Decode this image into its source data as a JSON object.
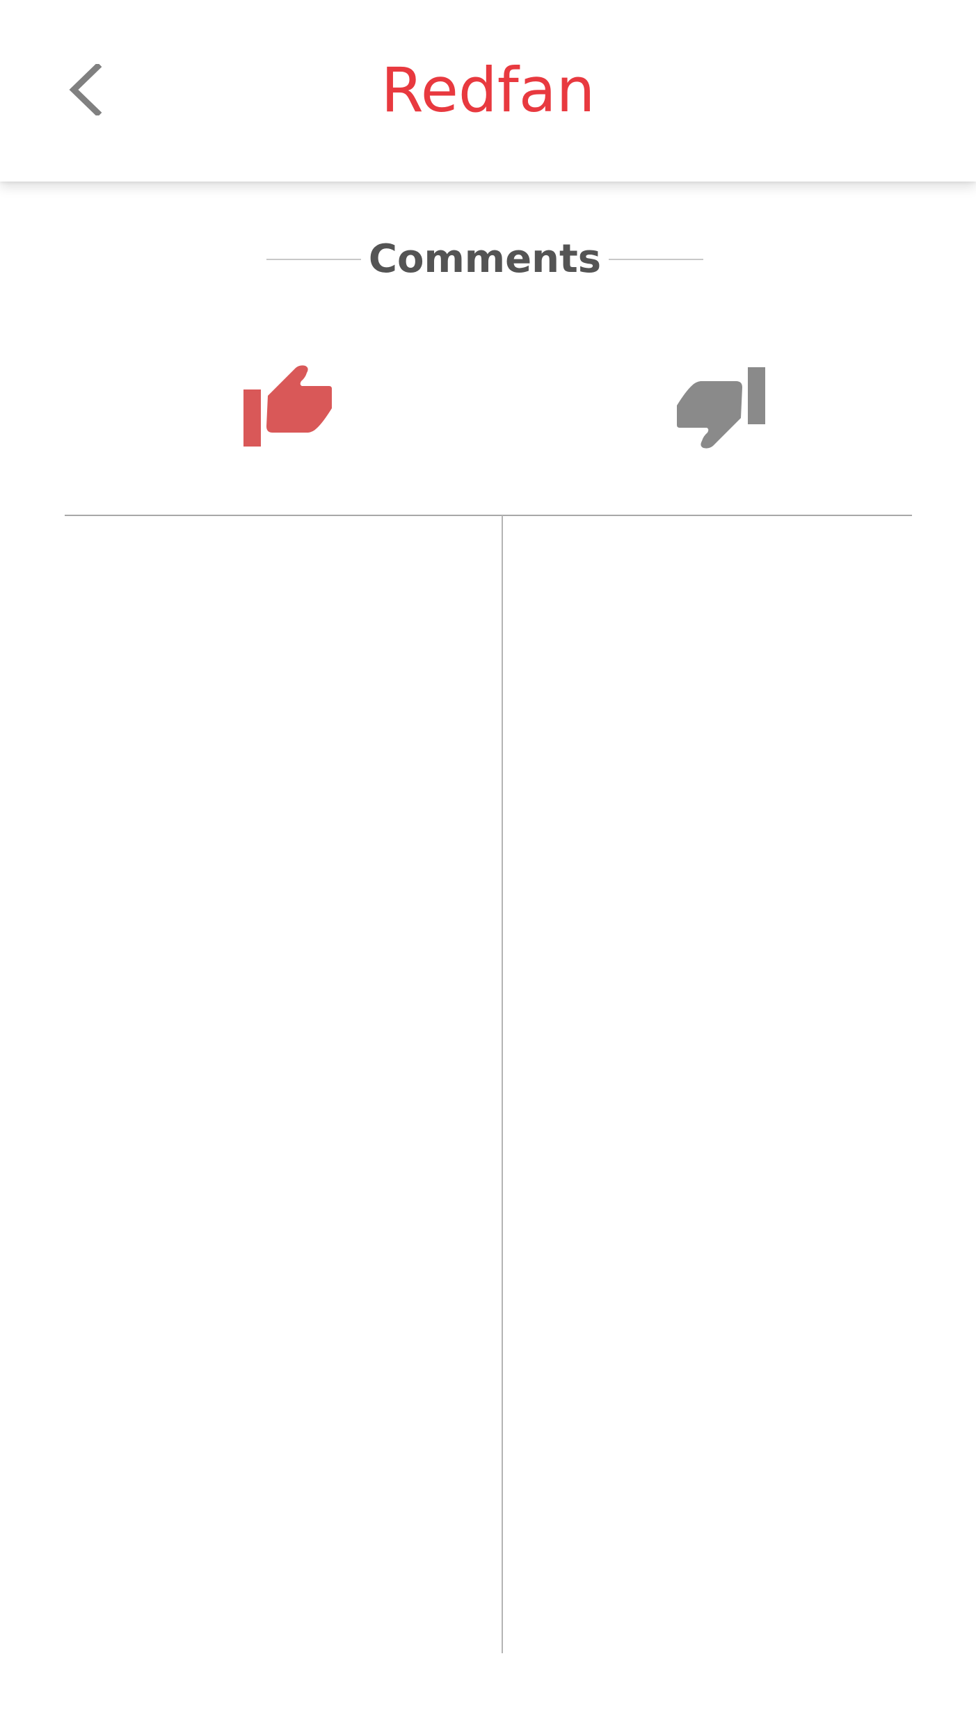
{
  "app_bar": {
    "title": "Redfan",
    "title_color": "#e8393f",
    "back_icon": "chevron-left-icon"
  },
  "section": {
    "title": "Comments"
  },
  "votes": {
    "up_icon": "thumbs-up-icon",
    "up_color": "#d95858",
    "down_icon": "thumbs-down-icon",
    "down_color": "#8a8a8a"
  },
  "columns": {
    "positive_comments": [],
    "negative_comments": []
  }
}
